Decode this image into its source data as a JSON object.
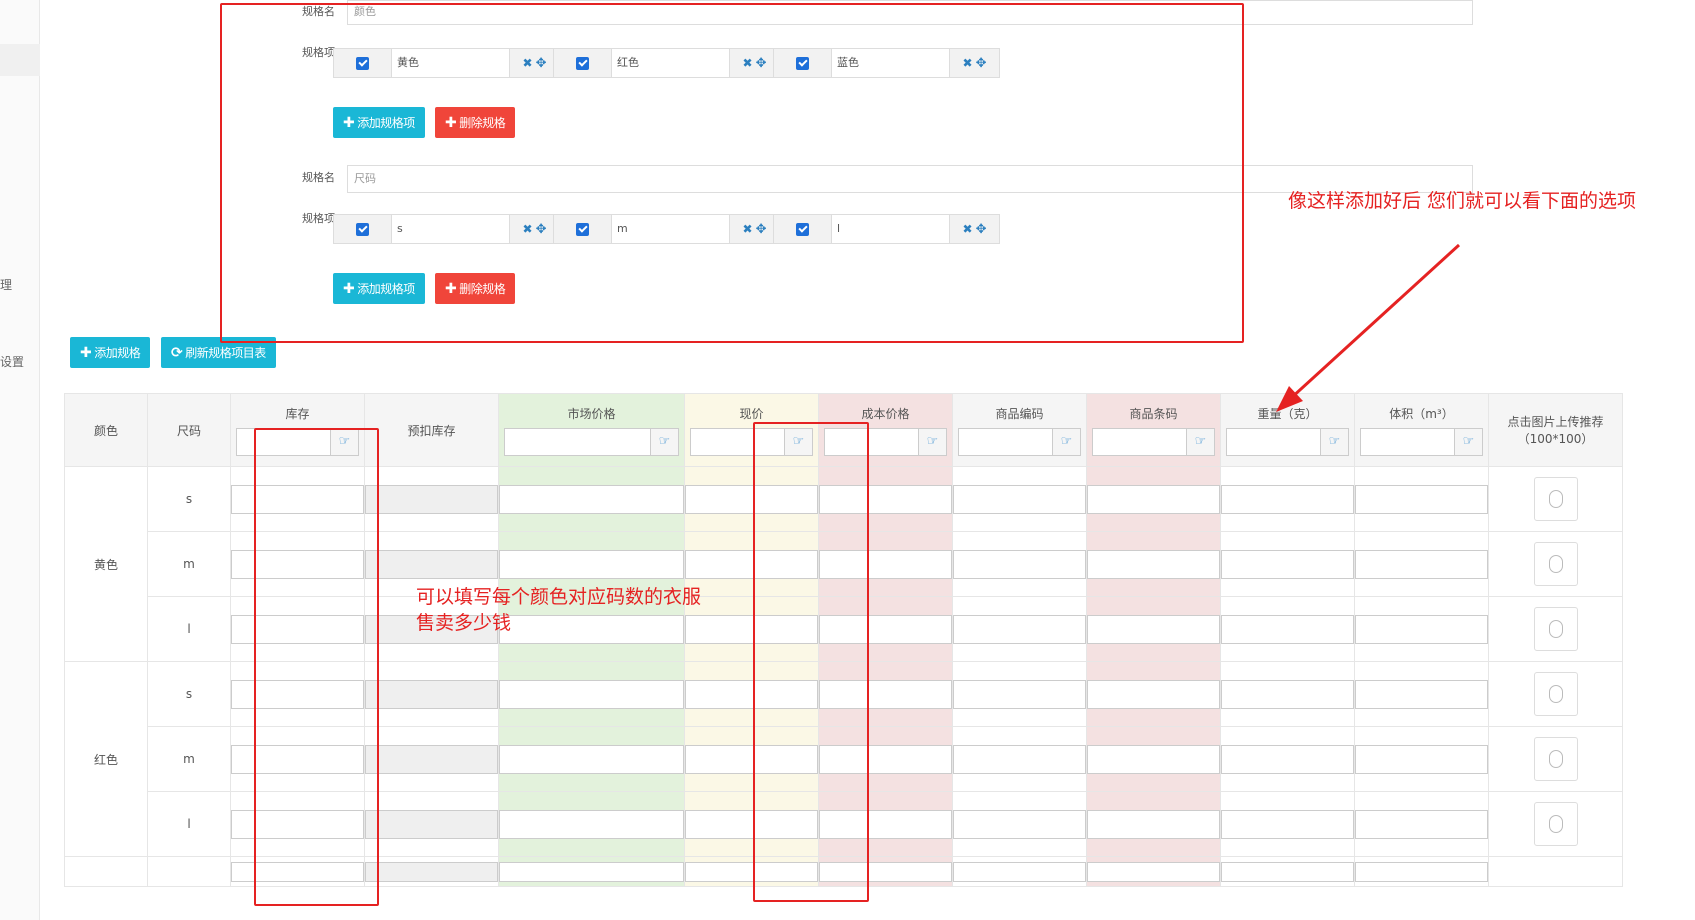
{
  "sidebar": {
    "fragments": [
      "理",
      "设置"
    ]
  },
  "specs": [
    {
      "name_label": "规格名",
      "name_value": "颜色",
      "items_label": "规格项",
      "items": [
        {
          "value": "黄色",
          "checked": true
        },
        {
          "value": "红色",
          "checked": true
        },
        {
          "value": "蓝色",
          "checked": true
        }
      ],
      "add_item_label": "添加规格项",
      "delete_label": "删除规格"
    },
    {
      "name_label": "规格名",
      "name_value": "尺码",
      "items_label": "规格项",
      "items": [
        {
          "value": "s",
          "checked": true
        },
        {
          "value": "m",
          "checked": true
        },
        {
          "value": "l",
          "checked": true
        }
      ],
      "add_item_label": "添加规格项",
      "delete_label": "删除规格"
    }
  ],
  "toolbar": {
    "add_spec_label": "添加规格",
    "refresh_label": "刷新规格项目表"
  },
  "annotations": {
    "top_right": "像这样添加好后 您们就可以看下面的选项",
    "middle_line1": "可以填写每个颜色对应码数的衣服",
    "middle_line2": "售卖多少钱"
  },
  "table": {
    "headers": [
      "颜色",
      "尺码",
      "库存",
      "预扣库存",
      "市场价格",
      "现价",
      "成本价格",
      "商品编码",
      "商品条码",
      "重量（克）",
      "体积（m³）",
      "点击图片上传推荐（100*100）"
    ],
    "groups": [
      {
        "color": "黄色",
        "sizes": [
          "s",
          "m",
          "l"
        ]
      },
      {
        "color": "红色",
        "sizes": [
          "s",
          "m",
          "l"
        ]
      }
    ]
  },
  "colors": {
    "accent_cyan": "#1ab7d6",
    "danger_red": "#f0453a",
    "annotation_red": "#e52222",
    "checkbox_blue": "#1e6fd9"
  }
}
